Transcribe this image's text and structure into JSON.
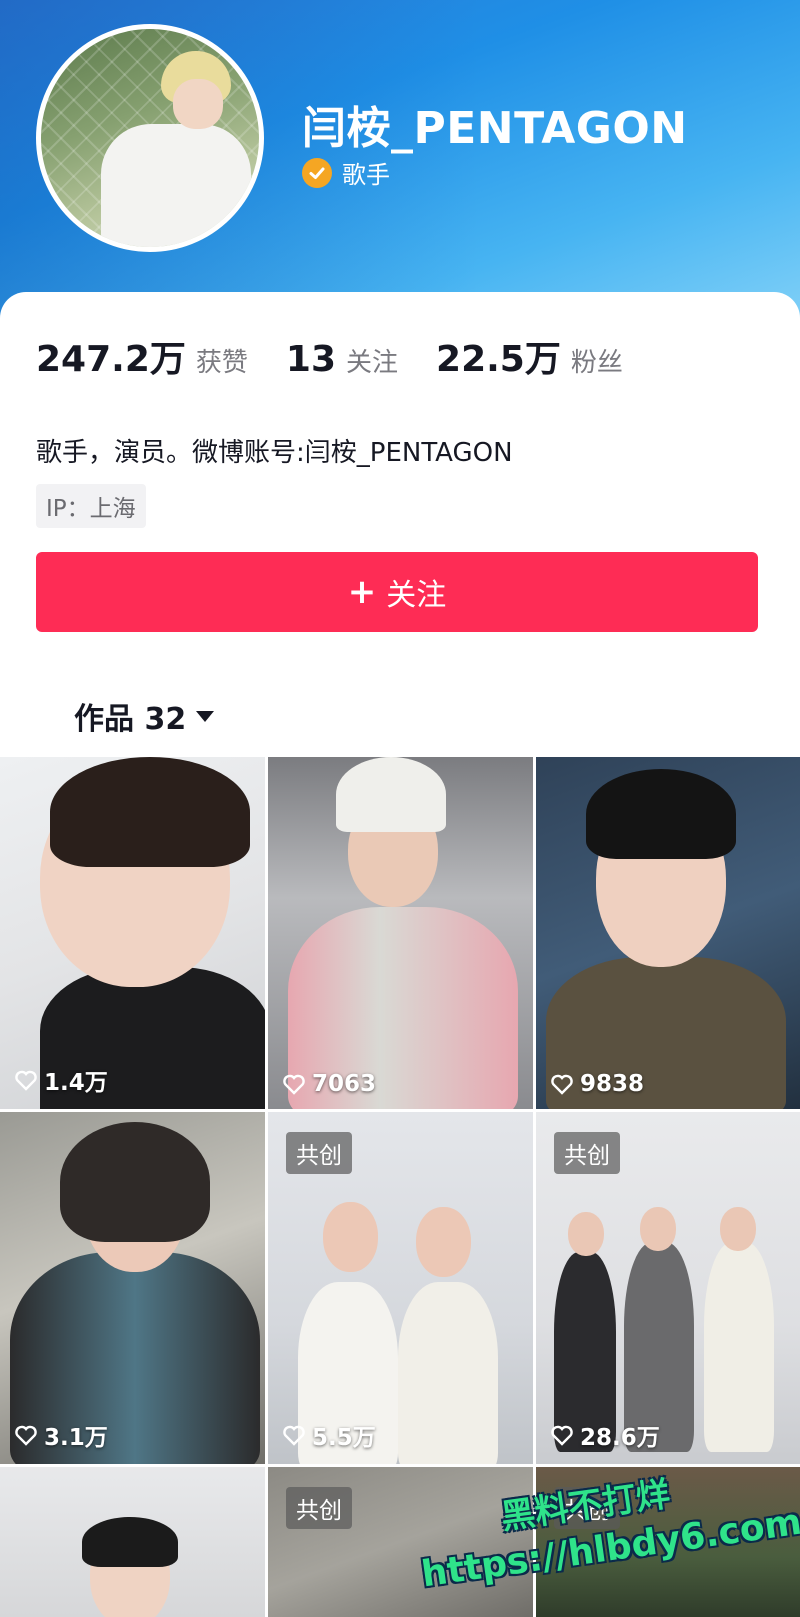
{
  "profile": {
    "name": "闫桉_PENTAGON",
    "verified_label": "歌手",
    "avatar": "avatar-photo"
  },
  "stats": [
    {
      "value": "247.2万",
      "label": "获赞"
    },
    {
      "value": "13",
      "label": "关注"
    },
    {
      "value": "22.5万",
      "label": "粉丝"
    }
  ],
  "bio": "歌手，演员。微博账号:闫桉_PENTAGON",
  "ip": "IP：上海",
  "follow_button": {
    "icon": "+",
    "label": "关注"
  },
  "works_tab": {
    "label": "作品 32"
  },
  "videos": [
    {
      "likes": "1.4万",
      "tag": ""
    },
    {
      "likes": "7063",
      "tag": ""
    },
    {
      "likes": "9838",
      "tag": ""
    },
    {
      "likes": "3.1万",
      "tag": ""
    },
    {
      "likes": "5.5万",
      "tag": "共创"
    },
    {
      "likes": "28.6万",
      "tag": "共创"
    },
    {
      "likes": "",
      "tag": ""
    },
    {
      "likes": "",
      "tag": "共创"
    },
    {
      "likes": "",
      "tag": "共创"
    }
  ],
  "watermark": {
    "line1": "黑料不打烊",
    "line2": "https://hlbdy6.com"
  },
  "colors": {
    "accent": "#fe2c55",
    "header": "#1f8fe6",
    "verified": "#f5a623"
  }
}
